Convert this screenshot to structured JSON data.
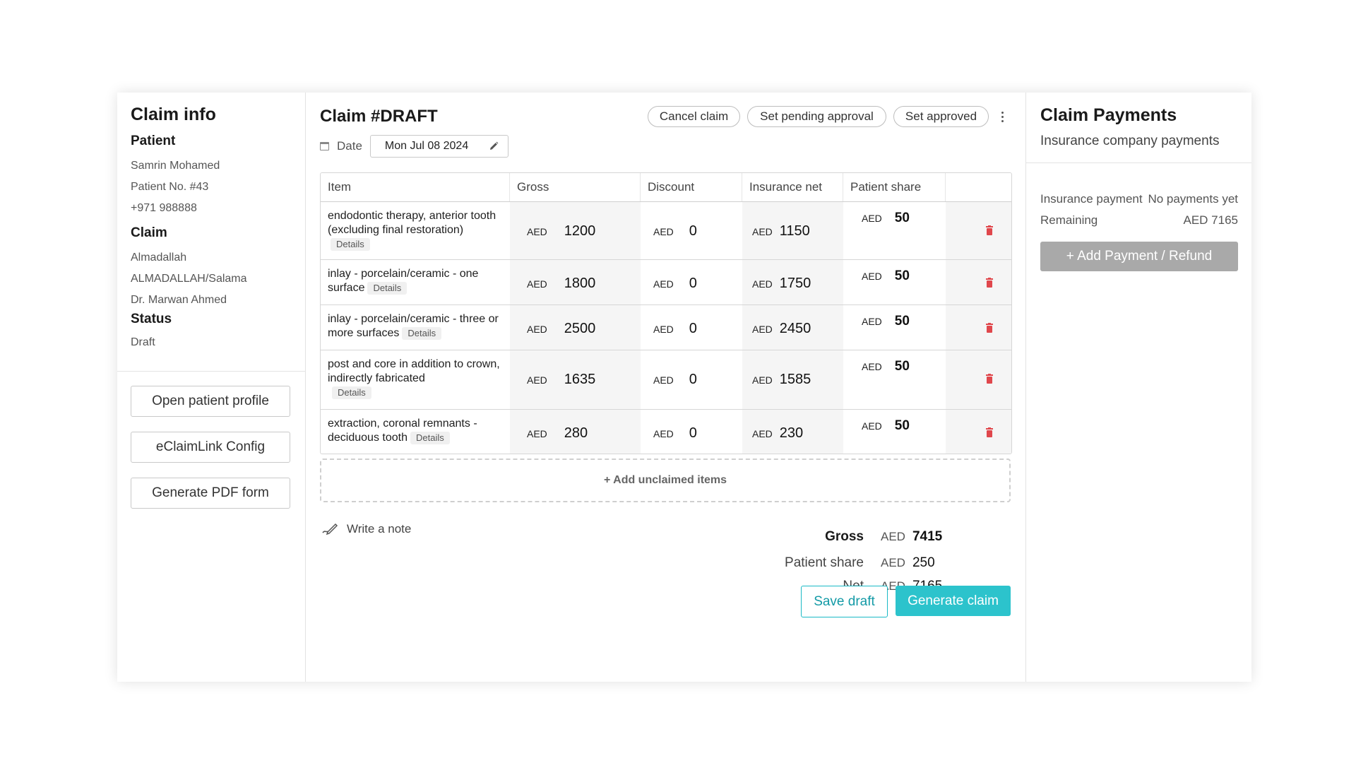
{
  "claim_info": {
    "title": "Claim info",
    "patient_heading": "Patient",
    "patient_name": "Samrin Mohamed",
    "patient_no": "Patient No. #43",
    "patient_phone": "+971 988888",
    "claim_heading": "Claim",
    "insurer": "Almadallah",
    "network": "ALMADALLAH/Salama",
    "doctor": "Dr. Marwan Ahmed",
    "status_heading": "Status",
    "status": "Draft",
    "buttons": {
      "open_profile": "Open patient profile",
      "eclaimlink": "eClaimLink Config",
      "generate_pdf": "Generate PDF form"
    }
  },
  "claim": {
    "title": "Claim #DRAFT",
    "actions": {
      "cancel": "Cancel claim",
      "pending": "Set pending approval",
      "approved": "Set approved"
    },
    "date_label": "Date",
    "date_value": "Mon Jul 08 2024",
    "columns": [
      "Item",
      "Gross",
      "Discount",
      "Insurance net",
      "Patient share",
      ""
    ],
    "details_label": "Details",
    "currency": "AED",
    "items": [
      {
        "name": "endodontic therapy, anterior tooth (excluding final restoration)",
        "gross": "1200",
        "discount": "0",
        "insurance_net": "1150",
        "patient_share": "50"
      },
      {
        "name": "inlay - porcelain/ceramic - one surface",
        "gross": "1800",
        "discount": "0",
        "insurance_net": "1750",
        "patient_share": "50"
      },
      {
        "name": "inlay - porcelain/ceramic - three or more surfaces",
        "gross": "2500",
        "discount": "0",
        "insurance_net": "2450",
        "patient_share": "50"
      },
      {
        "name": "post and core in addition to crown, indirectly fabricated",
        "gross": "1635",
        "discount": "0",
        "insurance_net": "1585",
        "patient_share": "50"
      },
      {
        "name": "extraction, coronal remnants - deciduous tooth",
        "gross": "280",
        "discount": "0",
        "insurance_net": "230",
        "patient_share": "50"
      }
    ],
    "add_unclaimed": "+ Add unclaimed items",
    "write_note": "Write a note",
    "totals": {
      "gross_label": "Gross",
      "gross_value": "7415",
      "patient_share_label": "Patient share",
      "patient_share_value": "250",
      "net_label": "Net",
      "net_value": "7165"
    },
    "save_draft": "Save draft",
    "generate_claim": "Generate claim"
  },
  "payments": {
    "title": "Claim Payments",
    "subtitle": "Insurance company payments",
    "insurance_payment_label": "Insurance payment",
    "insurance_payment_value": "No payments yet",
    "remaining_label": "Remaining",
    "remaining_value": "AED 7165",
    "add_button": "+ Add Payment / Refund"
  },
  "colors": {
    "accent": "#2cc3cc",
    "delete": "#e0474c",
    "disabled_button": "#a9a9a9"
  }
}
